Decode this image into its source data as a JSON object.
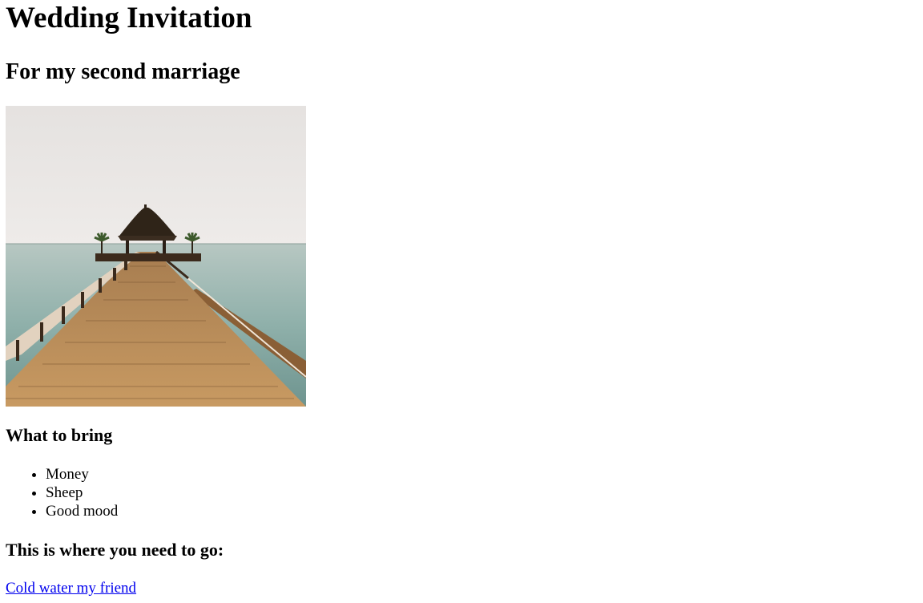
{
  "page": {
    "title": "Wedding Invitation",
    "subtitle": "For my second marriage"
  },
  "photo": {
    "description": "pier",
    "colors": {
      "sky": "#e9e6e4",
      "sea": "#9cb3ad",
      "wood": "#b88a57"
    }
  },
  "bring": {
    "heading": "What to bring",
    "items": [
      "Money",
      "Sheep",
      "Good mood"
    ]
  },
  "location": {
    "heading": "This is where you need to go:",
    "link_text": "Cold water my friend"
  }
}
